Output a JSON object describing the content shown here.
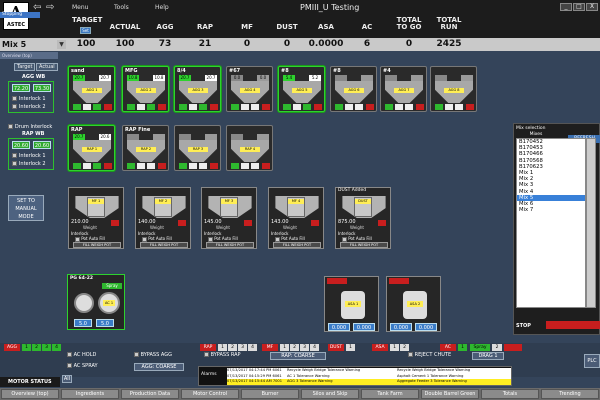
{
  "app": {
    "logo_text": "ASTEC",
    "title": "PMIII_U Testing",
    "menu": [
      "Menu",
      "Tools",
      "Help"
    ],
    "window_controls": [
      "_",
      "□",
      "X"
    ]
  },
  "header": {
    "labels": [
      "TARGET",
      "ACTUAL",
      "AGG",
      "RAP",
      "MF",
      "DUST",
      "ASA",
      "AC",
      "TOTAL TO GO",
      "TOTAL RUN"
    ],
    "values": [
      "100",
      "100",
      "73",
      "21",
      "0",
      "0",
      "0.0000",
      "6",
      "0",
      "2425"
    ],
    "target_button": "Set",
    "mix": "Mix 5",
    "status": "Stopping"
  },
  "overview_title": "Overview (top)",
  "left_panel": {
    "tabs": [
      "Target",
      "Actual"
    ],
    "agg_wb_label": "AGG WB",
    "agg_wb_values": [
      "72.20",
      "73.30"
    ],
    "agg_interlocks": [
      "Interlock 1",
      "Interlock 2"
    ],
    "drum_interlock": "Drum Interlock",
    "rap_wb_label": "RAP WB",
    "rap_wb_values": [
      "20.60",
      "20.60"
    ],
    "rap_interlocks": [
      "Interlock 1",
      "Interlock 2"
    ],
    "manual_button": "SET TO MANUAL MODE"
  },
  "bins_row1": [
    {
      "name": "sand",
      "bars": [
        "20.7",
        "20.7"
      ],
      "label": "AGG 1",
      "active": true
    },
    {
      "name": "MFG",
      "bars": [
        "10.8",
        "10.8"
      ],
      "label": "AGG 2",
      "active": true
    },
    {
      "name": "8/4",
      "bars": [
        "20.7",
        "20.7"
      ],
      "label": "AGG 3",
      "active": true
    },
    {
      "name": "#67",
      "bars": [
        "0.0",
        "0.0"
      ],
      "label": "AGG 4",
      "active": false
    },
    {
      "name": "#8",
      "bars": [
        "5.4",
        "5.2"
      ],
      "label": "AGG 5",
      "active": true
    },
    {
      "name": "#8",
      "bars": [
        "",
        ""
      ],
      "label": "AGG 6",
      "active": false
    },
    {
      "name": "#4",
      "bars": [
        "",
        ""
      ],
      "label": "AGG 7",
      "active": false
    },
    {
      "name": "",
      "bars": [
        "",
        ""
      ],
      "label": "AGG 8",
      "active": false
    }
  ],
  "bins_row2": [
    {
      "name": "RAP",
      "bars": [
        "20.7",
        "20.6"
      ],
      "label": "RAP 1",
      "active": true
    },
    {
      "name": "RAP Fine",
      "bars": [
        "",
        ""
      ],
      "label": "RAP 2",
      "active": false
    },
    {
      "name": "",
      "bars": [
        "",
        ""
      ],
      "label": "RAP 3",
      "active": false
    },
    {
      "name": "",
      "bars": [
        "",
        ""
      ],
      "label": "RAP 4",
      "active": false
    }
  ],
  "weigh_pots": [
    {
      "name": "",
      "label": "MF 1",
      "weight": "210.00",
      "weight_label": "Weight",
      "interlock": "Interlock",
      "autofill": "Pot Auto Fill",
      "fill": "FILL WEIGH POT"
    },
    {
      "name": "",
      "label": "MF 2",
      "weight": "140.00",
      "weight_label": "Weight",
      "interlock": "Interlock",
      "autofill": "Pot Auto Fill",
      "fill": "FILL WEIGH POT"
    },
    {
      "name": "",
      "label": "MF 3",
      "weight": "145.00",
      "weight_label": "Weight",
      "interlock": "Interlock",
      "autofill": "Pot Auto Fill",
      "fill": "FILL WEIGH POT"
    },
    {
      "name": "",
      "label": "MF 4",
      "weight": "143.00",
      "weight_label": "Weight",
      "interlock": "Interlock",
      "autofill": "Pot Auto Fill",
      "fill": "FILL WEIGH POT"
    },
    {
      "name": "DUST Added",
      "label": "DUST",
      "weight": "875.00",
      "weight_label": "Weight",
      "interlock": "Interlock",
      "autofill": "Pot Auto Fill",
      "fill": "FILL WEIGH POT"
    }
  ],
  "ac_tank": {
    "name": "PG 64-22",
    "label": "AC 1",
    "badge": "Spray",
    "values": [
      "5.0",
      "5.0"
    ]
  },
  "asa_tanks": [
    {
      "label": "ASA 1",
      "values": [
        "0.000",
        "0.000"
      ]
    },
    {
      "label": "ASA 2",
      "values": [
        "0.000",
        "0.000"
      ]
    }
  ],
  "mix_selection": {
    "title": "Mix selection",
    "column": "Mixes",
    "refresh": "REFRESH",
    "items": [
      "B170452",
      "B170453",
      "B170466",
      "B170568",
      "B170623",
      "Mix 1",
      "Mix 2",
      "Mix 3",
      "Mix 4",
      "Mix 5",
      "Mix 6",
      "Mix 7"
    ],
    "selected": "Mix 5",
    "stop_label": "STOP"
  },
  "bottom": {
    "agg_label": "AGG",
    "agg_cells": [
      "1",
      "2",
      "3",
      "4"
    ],
    "ac_hold": "AC HOLD",
    "ac_spray": "AC SPRAY",
    "bypass_agg": "BYPASS AGG",
    "agg_coarse": "AGG: COARSE",
    "rap_label": "RAP",
    "rap_cells": [
      "1",
      "2",
      "3",
      "4"
    ],
    "bypass_rap": "BYPASS RAP",
    "mf_label": "MF",
    "mf_cells": [
      "1",
      "2",
      "3",
      "4"
    ],
    "rap_coarse": "RAP: COARSE",
    "dust_label": "DUST",
    "dust_cells": [
      "1"
    ],
    "asa_label": "ASA",
    "asa_cells": [
      "1",
      "2"
    ],
    "reject_chute": "REJECT CHUTE",
    "drag": "DRAG 1",
    "ac_label": "AC",
    "ac_cells": [
      "1"
    ],
    "spray": "Spray",
    "dash": "2",
    "motor_status": "MOTOR STATUS",
    "all_button": "All",
    "alarms_label": "Alarms",
    "alarms": [
      {
        "time": "07/13/2017 04:17:44 PM 6061",
        "msg": "Recycle Weigh Bridge Tolerance Warning",
        "msg2": "Recycle Weigh Bridge Tolerance Warning",
        "color": "#ffffff"
      },
      {
        "time": "07/13/2017 04:15:29 PM 6061",
        "msg": "AC 1 Tolerance Warning",
        "msg2": "Asphalt Cement 1 Tolerance Warning",
        "color": "#ffffff"
      },
      {
        "time": "07/13/2017 04:15:44 AM 7001",
        "msg": "AGG 3 Tolerance Warning",
        "msg2": "Aggregate Feeder 3 Tolerance Warning",
        "color": "#ffee22"
      }
    ],
    "plc": "PLC"
  },
  "nav_tabs": [
    "Overview (top)",
    "Ingredients",
    "Production Data",
    "Motor Control",
    "Burner",
    "Silos and Skip",
    "Tank Farm",
    "Double Barrel Green",
    "Totals",
    "Trending"
  ]
}
